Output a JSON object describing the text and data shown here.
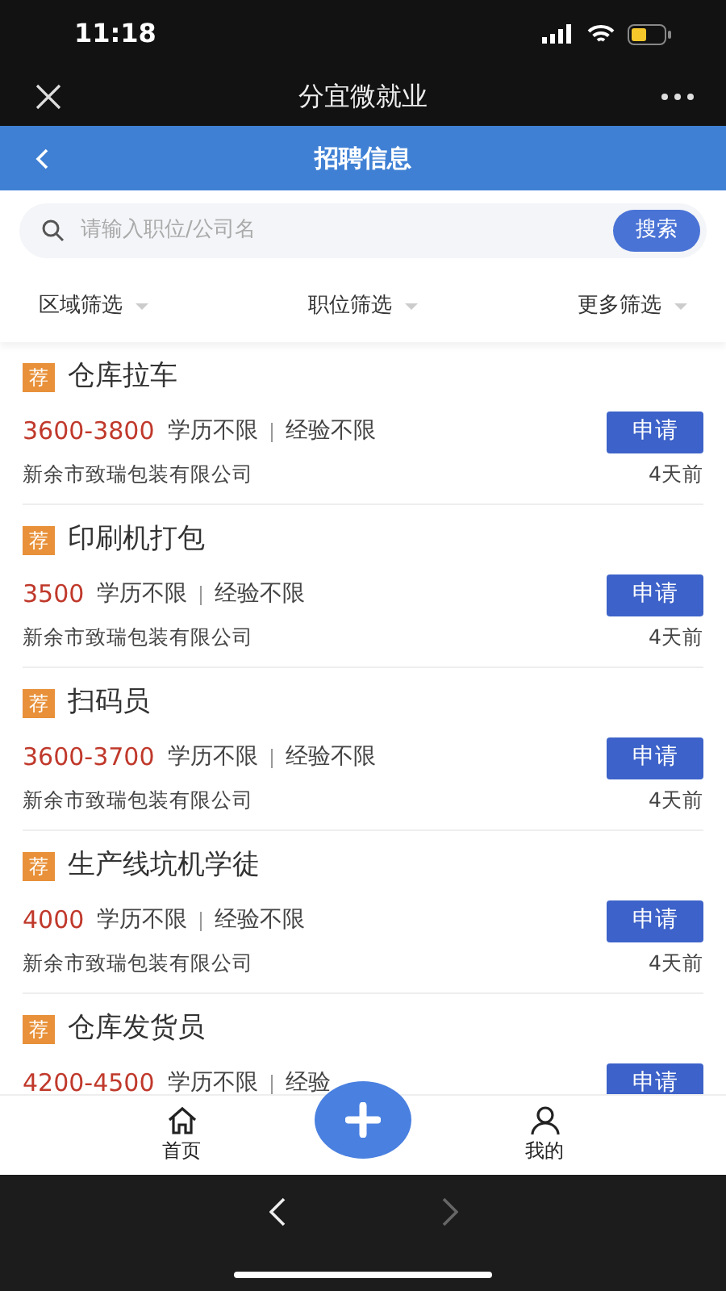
{
  "status_bar": {
    "time": "11:18"
  },
  "app_bar": {
    "title": "分宜微就业"
  },
  "header": {
    "title": "招聘信息"
  },
  "search": {
    "placeholder": "请输入职位/公司名",
    "button": "搜索"
  },
  "filters": [
    "区域筛选",
    "职位筛选",
    "更多筛选"
  ],
  "jobs": [
    {
      "tag": "荐",
      "title": "仓库拉车",
      "salary": "3600-3800",
      "education": "学历不限",
      "experience": "经验不限",
      "apply": "申请",
      "company": "新余市致瑞包装有限公司",
      "posted": "4天前"
    },
    {
      "tag": "荐",
      "title": "印刷机打包",
      "salary": "3500",
      "education": "学历不限",
      "experience": "经验不限",
      "apply": "申请",
      "company": "新余市致瑞包装有限公司",
      "posted": "4天前"
    },
    {
      "tag": "荐",
      "title": "扫码员",
      "salary": "3600-3700",
      "education": "学历不限",
      "experience": "经验不限",
      "apply": "申请",
      "company": "新余市致瑞包装有限公司",
      "posted": "4天前"
    },
    {
      "tag": "荐",
      "title": "生产线坑机学徒",
      "salary": "4000",
      "education": "学历不限",
      "experience": "经验不限",
      "apply": "申请",
      "company": "新余市致瑞包装有限公司",
      "posted": "4天前"
    },
    {
      "tag": "荐",
      "title": "仓库发货员",
      "salary": "4200-4500",
      "education": "学历不限",
      "experience": "经验",
      "apply": "申请"
    }
  ],
  "tab_bar": [
    {
      "label": "首页",
      "kind": "home"
    },
    {
      "kind": "add"
    },
    {
      "label": "我的",
      "kind": "profile"
    }
  ],
  "browser_nav": {
    "back_disabled": false,
    "forward_disabled": true
  }
}
